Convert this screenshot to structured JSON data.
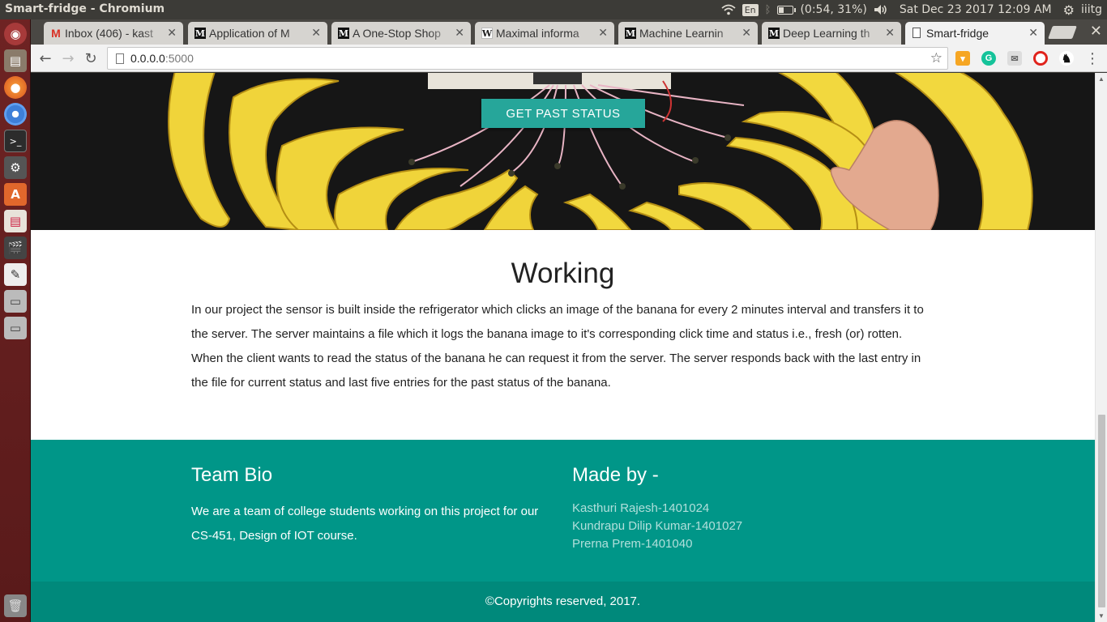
{
  "os": {
    "window_title": "Smart-fridge - Chromium",
    "keyboard_layout": "En",
    "battery_text": "(0:54, 31%)",
    "battery_level": 0.31,
    "datetime": "Sat Dec 23 2017 12:09 AM",
    "username": "iiitg"
  },
  "browser": {
    "tabs": [
      {
        "title": "Inbox (406) - kast",
        "favicon": "gmail-icon"
      },
      {
        "title": "Application of M",
        "favicon": "medium-icon"
      },
      {
        "title": "A One-Stop Shop",
        "favicon": "medium-icon"
      },
      {
        "title": "Maximal informa",
        "favicon": "wikipedia-icon"
      },
      {
        "title": "Machine Learnin",
        "favicon": "medium-icon"
      },
      {
        "title": "Deep Learning th",
        "favicon": "medium-icon"
      },
      {
        "title": "Smart-fridge",
        "favicon": "page-icon",
        "active": true
      }
    ],
    "url_host": "0.0.0.0",
    "url_port": ":5000"
  },
  "page": {
    "hero": {
      "button_label": "GET PAST STATUS"
    },
    "working": {
      "title": "Working",
      "body": "In our project the sensor is built inside the refrigerator which clicks an image of the banana for every 2 minutes interval and transfers it to the server. The server maintains a file which it logs the banana image to it's corresponding click time and status i.e., fresh (or) rotten. When the client wants to read the status of the banana he can request it from the server. The server responds back with the last entry in the file for current status and last five entries for the past status of the banana."
    },
    "footer": {
      "bio_title": "Team Bio",
      "bio_text": "We are a team of college students working on this project for our CS-451, Design of IOT course.",
      "made_by_title": "Made by -",
      "members": [
        "Kasthuri Rajesh-1401024",
        "Kundrapu Dilip Kumar-1401027",
        "Prerna Prem-1401040"
      ],
      "copyright": "©Copyrights reserved, 2017."
    }
  },
  "colors": {
    "teal": "#009688",
    "teal_dark": "#00897b",
    "button": "#26a69a",
    "launcher": "#6e2323"
  }
}
